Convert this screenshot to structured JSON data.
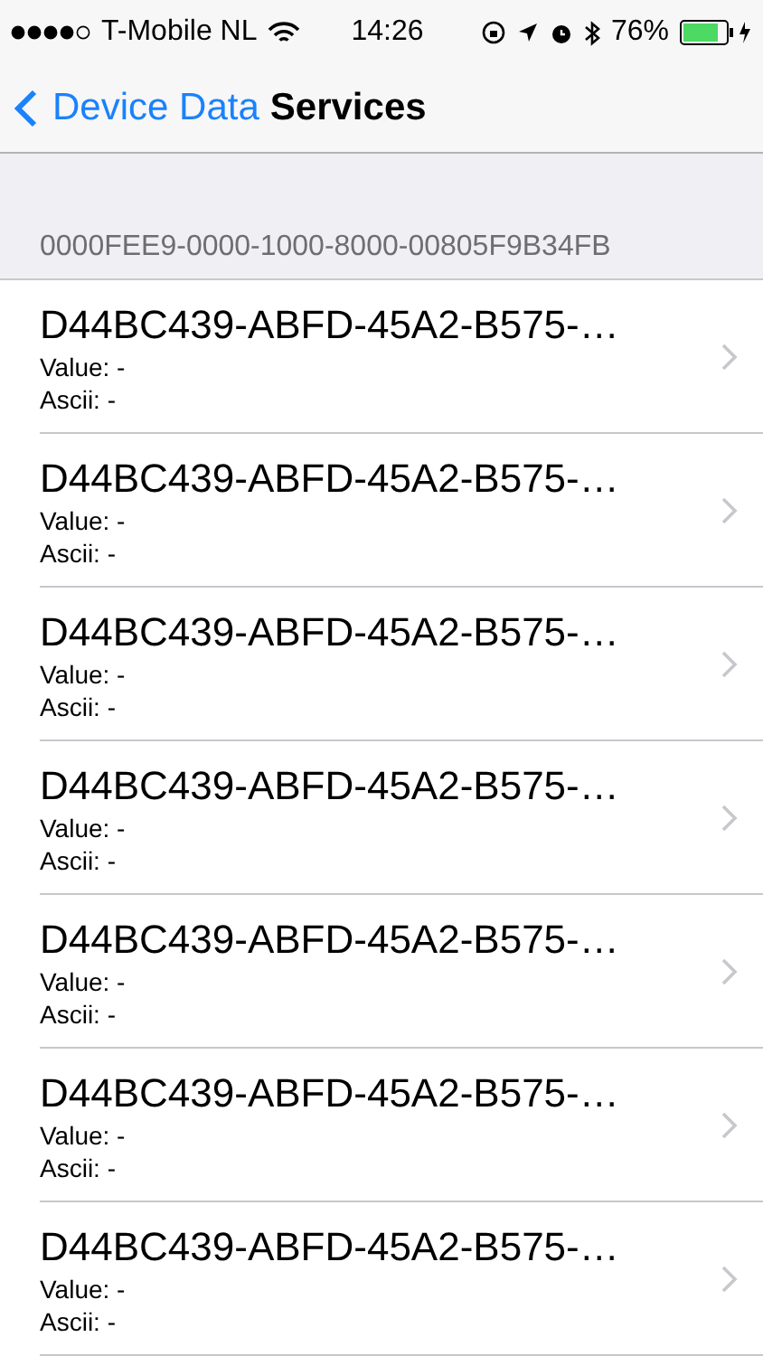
{
  "status_bar": {
    "carrier": "T-Mobile NL",
    "time": "14:26",
    "battery": "76%"
  },
  "nav": {
    "back": "Device Data",
    "title": "Services"
  },
  "section": {
    "header": "0000FEE9-0000-1000-8000-00805F9B34FB",
    "rows": [
      {
        "title": "D44BC439-ABFD-45A2-B575-…",
        "value": "Value: -",
        "ascii": "Ascii: -"
      },
      {
        "title": "D44BC439-ABFD-45A2-B575-…",
        "value": "Value: -",
        "ascii": "Ascii: -"
      },
      {
        "title": "D44BC439-ABFD-45A2-B575-…",
        "value": "Value: -",
        "ascii": "Ascii: -"
      },
      {
        "title": "D44BC439-ABFD-45A2-B575-…",
        "value": "Value: -",
        "ascii": "Ascii: -"
      },
      {
        "title": "D44BC439-ABFD-45A2-B575-…",
        "value": "Value: -",
        "ascii": "Ascii: -"
      },
      {
        "title": "D44BC439-ABFD-45A2-B575-…",
        "value": "Value: -",
        "ascii": "Ascii: -"
      },
      {
        "title": "D44BC439-ABFD-45A2-B575-…",
        "value": "Value: -",
        "ascii": "Ascii: -"
      }
    ]
  }
}
